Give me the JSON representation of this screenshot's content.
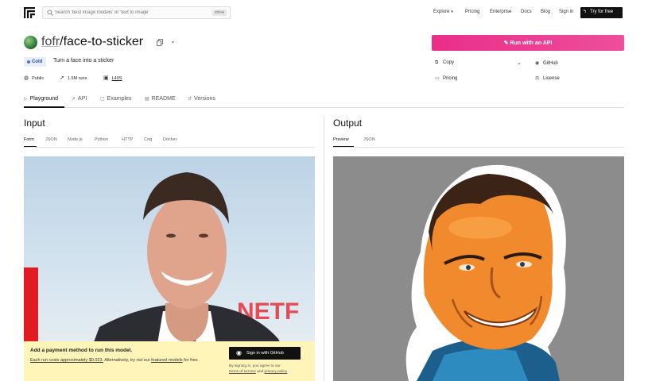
{
  "nav": {
    "search_placeholder": "Search 'best image models' or 'text to image'",
    "search_shortcut": "ctrl+k",
    "explore": "Explore",
    "pricing": "Pricing",
    "enterprise": "Enterprise",
    "docs": "Docs",
    "blog": "Blog",
    "sign_in": "Sign in",
    "try_free": "Try for free"
  },
  "model": {
    "owner": "fofr",
    "separator": "/",
    "name": "face-to-sticker",
    "status": "Cold",
    "description": "Turn a face into a sticker",
    "visibility": "Public",
    "runs": "1.5M runs",
    "license": "L40S"
  },
  "actions": {
    "run_api": "Run with an API",
    "copy": "Copy",
    "github": "GitHub",
    "pricing": "Pricing",
    "license": "License"
  },
  "tabs": [
    "Playground",
    "API",
    "Examples",
    "README",
    "Versions"
  ],
  "input": {
    "title": "Input",
    "subtabs": [
      "Form",
      "JSON",
      "Node.js",
      "Python",
      "HTTP",
      "Cog",
      "Docker"
    ]
  },
  "output": {
    "title": "Output",
    "subtabs": [
      "Preview",
      "JSON"
    ]
  },
  "banner": {
    "title": "Add a payment method to run this model.",
    "text_link": "Each run costs approximately $0.023.",
    "text_mid": " Alternatively, try out our ",
    "text_link2": "featured models",
    "text_end": " for free.",
    "button": "Sign in with GitHub",
    "fine_1": "By signing in, you agree to our",
    "fine_terms": "terms of service",
    "fine_and": " and ",
    "fine_privacy": "privacy policy"
  },
  "colors": {
    "accent": "#ea2e8a",
    "status_cold_bg": "#e8eefc",
    "status_cold_text": "#2b4fb5",
    "banner_bg": "#fff5b8"
  }
}
